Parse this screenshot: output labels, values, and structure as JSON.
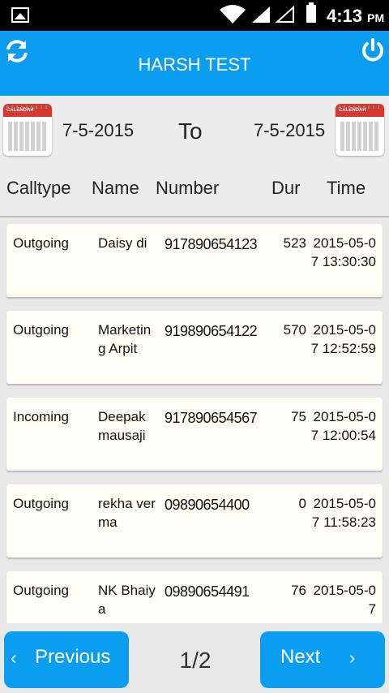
{
  "status_bar": {
    "time": "4:13",
    "ampm": "PM"
  },
  "app_bar": {
    "title": "HARSH TEST"
  },
  "date_filter": {
    "from": "7-5-2015",
    "to_label": "To",
    "to": "7-5-2015",
    "calendar_label": "CALENDAR"
  },
  "columns": [
    "Calltype",
    "Name",
    "Number",
    "Dur",
    "Time"
  ],
  "calls": [
    {
      "type": "Outgoing",
      "name": "Daisy di",
      "number": "917890654123",
      "dur": "523",
      "time": "2015-05-07 13:30:30"
    },
    {
      "type": "Outgoing",
      "name": "Marketing Arpit",
      "number": "919890654122",
      "dur": "570",
      "time": "2015-05-07 12:52:59"
    },
    {
      "type": "Incoming",
      "name": "Deepak mausaji",
      "number": "917890654567",
      "dur": "75",
      "time": "2015-05-07 12:00:54"
    },
    {
      "type": "Outgoing",
      "name": "rekha verma",
      "number": "09890654400",
      "dur": "0",
      "time": "2015-05-07 11:58:23"
    },
    {
      "type": "Outgoing",
      "name": "NK Bhaiya",
      "number": "09890654491",
      "dur": "76",
      "time": "2015-05-07"
    }
  ],
  "pagination": {
    "previous": "Previous",
    "page": "1/2",
    "next": "Next"
  },
  "icons": {
    "refresh": "refresh-icon",
    "power": "power-icon",
    "calendar": "calendar-icon"
  },
  "colors": {
    "accent": "#0b9df0",
    "card": "#fffef4"
  }
}
